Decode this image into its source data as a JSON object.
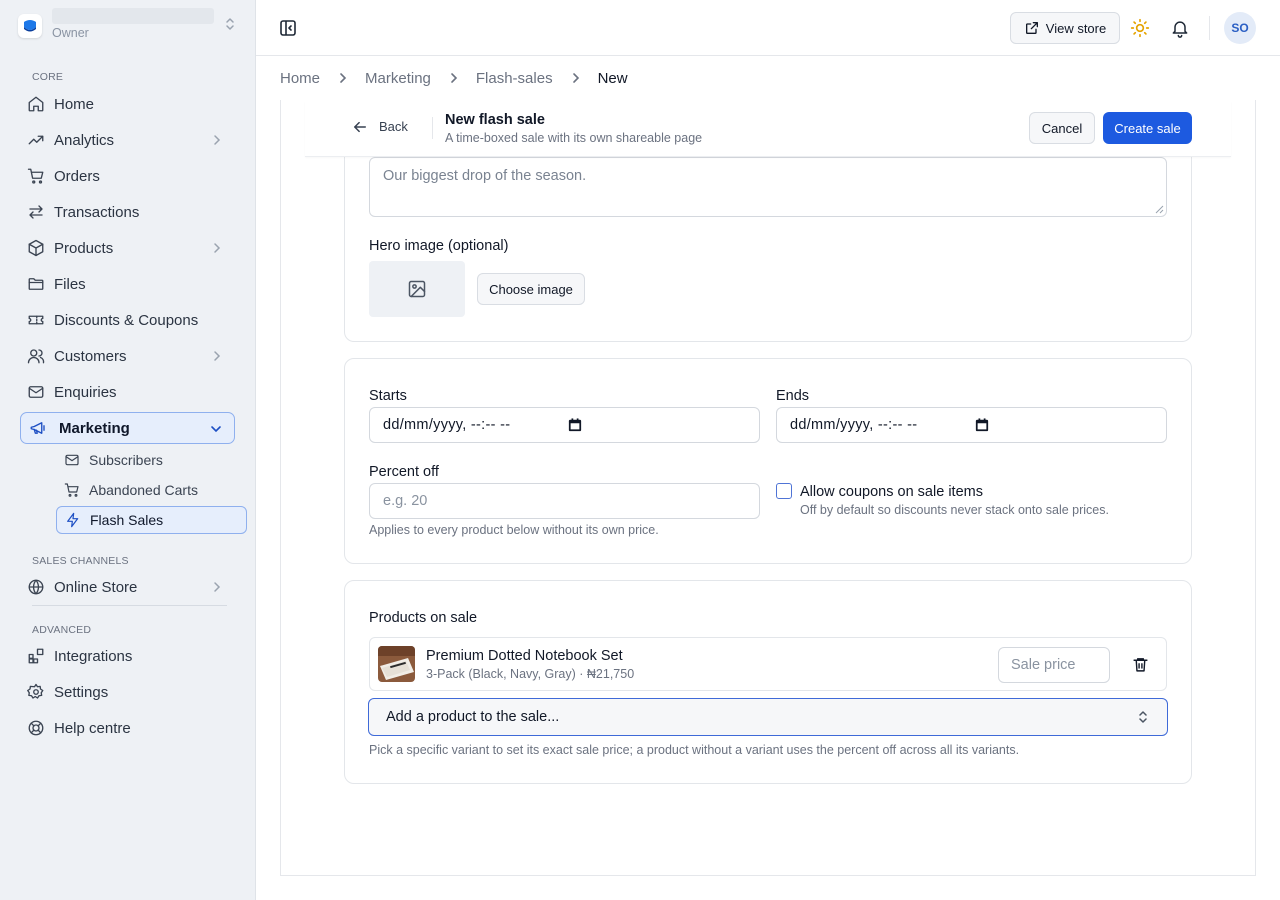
{
  "sidebar": {
    "store_role": "Owner",
    "sections": {
      "core": "CORE",
      "sales_channels": "SALES CHANNELS",
      "advanced": "ADVANCED"
    },
    "items": {
      "home": "Home",
      "analytics": "Analytics",
      "orders": "Orders",
      "transactions": "Transactions",
      "products": "Products",
      "files": "Files",
      "discounts": "Discounts & Coupons",
      "customers": "Customers",
      "enquiries": "Enquiries",
      "marketing": "Marketing",
      "subscribers": "Subscribers",
      "abandoned_carts": "Abandoned Carts",
      "flash_sales": "Flash Sales",
      "online_store": "Online Store",
      "integrations": "Integrations",
      "settings": "Settings",
      "help_centre": "Help centre"
    }
  },
  "topbar": {
    "view_store": "View store",
    "avatar_initials": "SO"
  },
  "breadcrumb": {
    "home": "Home",
    "marketing": "Marketing",
    "flash_sales": "Flash-sales",
    "current": "New"
  },
  "header": {
    "back": "Back",
    "title": "New flash sale",
    "subtitle": "A time-boxed sale with its own shareable page",
    "cancel": "Cancel",
    "create": "Create sale"
  },
  "form": {
    "description_placeholder": "Our biggest drop of the season.",
    "hero_label": "Hero image (optional)",
    "choose_image": "Choose image",
    "starts_label": "Starts",
    "starts_value": "dd/mm/yyyy, --:-- --",
    "ends_label": "Ends",
    "ends_value": "dd/mm/yyyy, --:-- --",
    "percent_label": "Percent off",
    "percent_placeholder": "e.g. 20",
    "percent_help": "Applies to every product below without its own price.",
    "allow_coupons_label": "Allow coupons on sale items",
    "allow_coupons_help": "Off by default so discounts never stack onto sale prices.",
    "allow_coupons_checked": false,
    "products_label": "Products on sale",
    "products": [
      {
        "name": "Premium Dotted Notebook Set",
        "details": "3-Pack (Black, Navy, Gray) · ₦21,750",
        "sale_price_placeholder": "Sale price"
      }
    ],
    "add_product": "Add a product to the sale...",
    "products_help": "Pick a specific variant to set its exact sale price; a product without a variant uses the percent off across all its variants."
  },
  "colors": {
    "primary": "#1d5ae0",
    "sidebar_bg": "#eef1f5",
    "active_bg": "#e6eefc",
    "sun": "#e5a300"
  }
}
